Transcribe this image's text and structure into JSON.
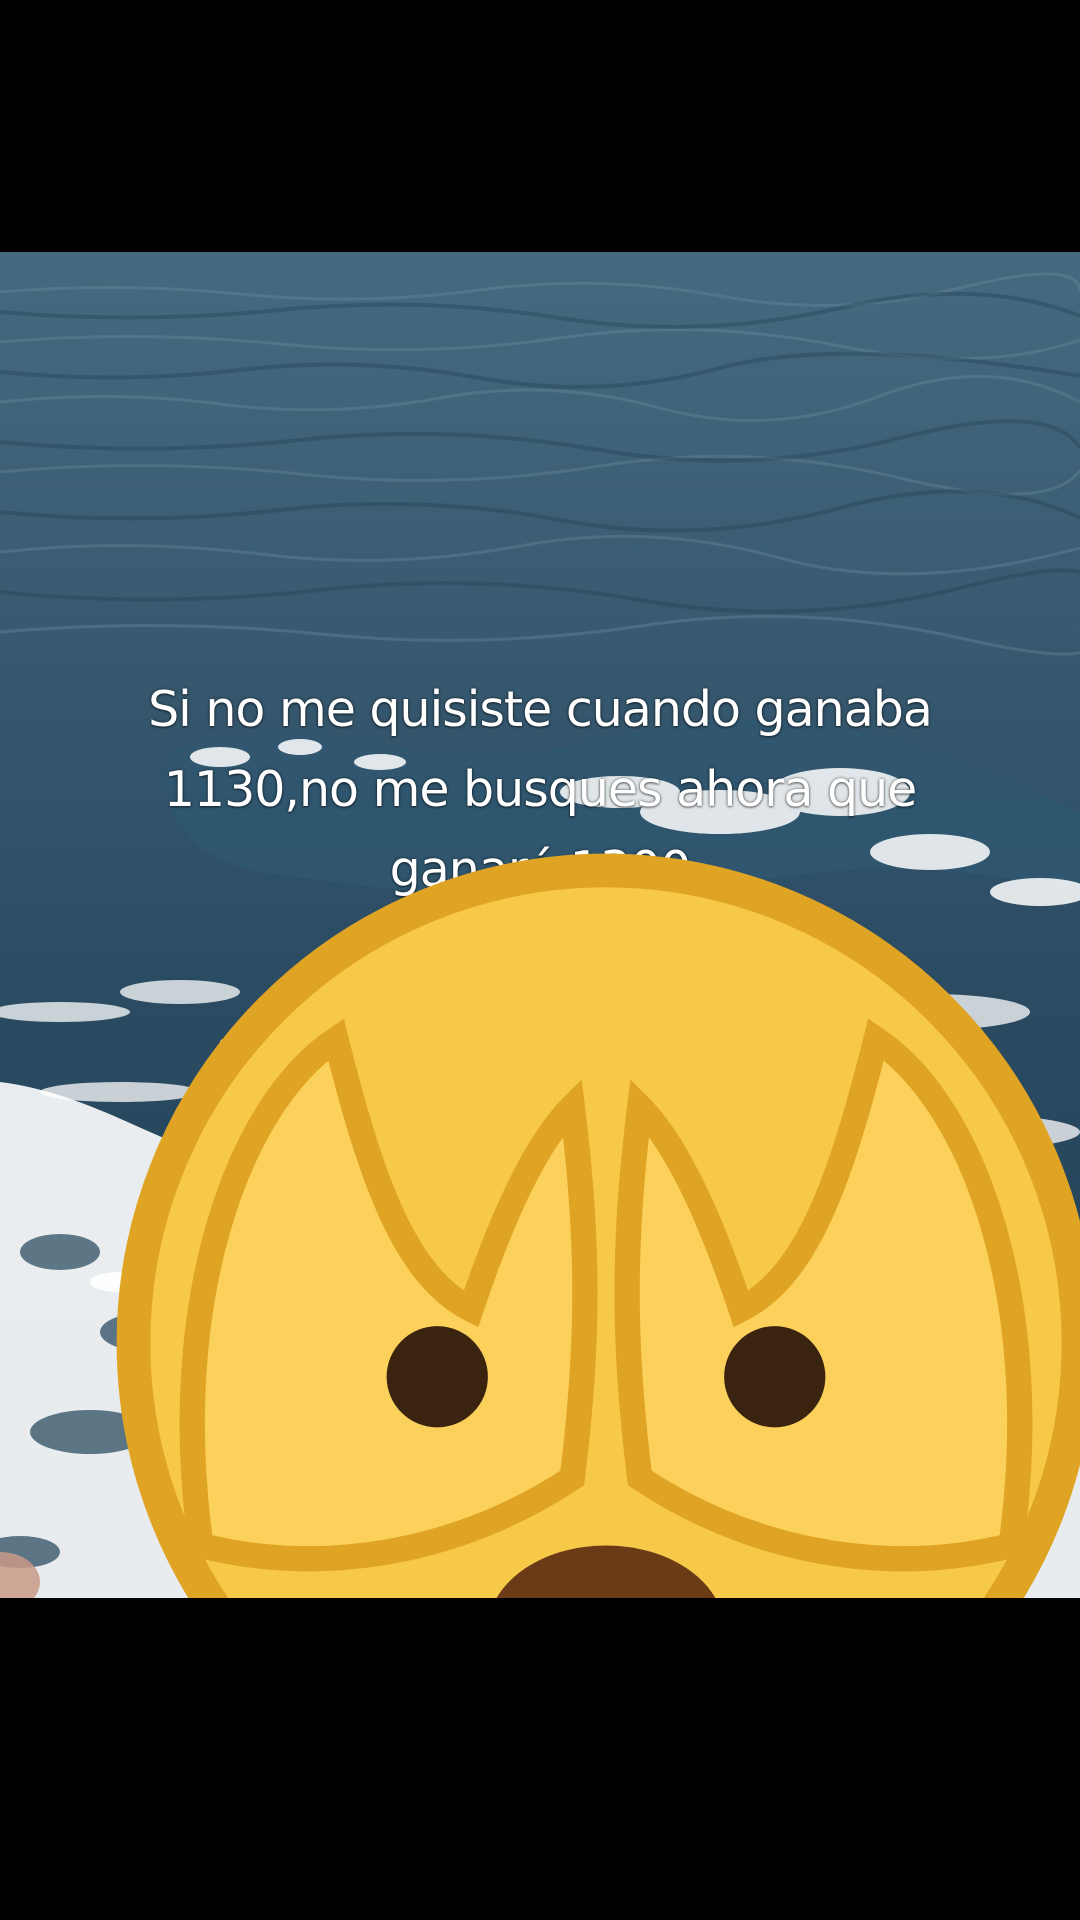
{
  "video": {
    "caption_text": "Si no me quisiste cuando ganaba\n1130,no me busques ahora que\nganaré 1300",
    "caption_emoji": "face-with-peeking-eye-icon",
    "scene": "sea-waves",
    "colors": {
      "sea_deep": "#25465c",
      "sea_light": "#3f6379",
      "foam": "#ffffff",
      "letterbox": "#000000"
    }
  }
}
